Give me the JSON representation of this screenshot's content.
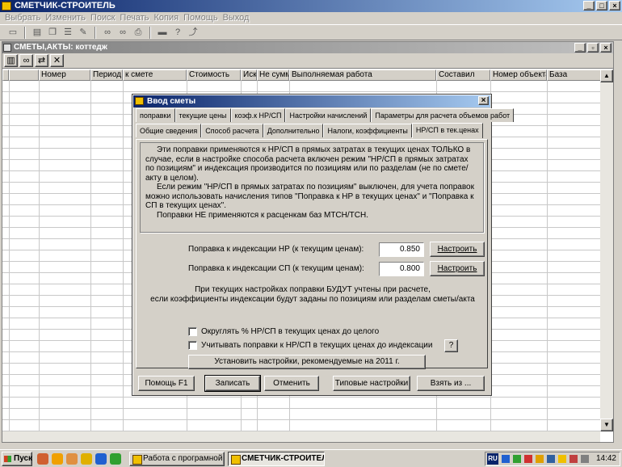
{
  "app": {
    "title": "СМЕТЧИК-СТРОИТЕЛЬ"
  },
  "menu": [
    "Выбрать",
    "Изменить",
    "Поиск",
    "Печать",
    "Копия",
    "Помощь",
    "Выход"
  ],
  "child_window": {
    "title": "СМЕТЫ,АКТЫ: коттедж",
    "columns": [
      "Номер",
      "Период",
      "к смете",
      "Стоимость",
      "Иск.",
      "Не сумм",
      "Выполняемая работа",
      "Составил",
      "Номер объекта",
      "База"
    ]
  },
  "dialog": {
    "title": "Ввод сметы",
    "tabs_row1": [
      "поправки",
      "текущие цены",
      "коэф.к НР/СП",
      "Настройки начислений",
      "Параметры для расчета объемов работ"
    ],
    "tabs_row2": [
      "Общие сведения",
      "Способ расчета",
      "Дополнительно",
      "Налоги, коэффициенты",
      "НР/СП в тек.ценах"
    ],
    "active_tab": "НР/СП в тек.ценах",
    "info_paragraphs": [
      "Эти поправки применяются к НР/СП в прямых затратах в текущих ценах ТОЛЬКО в случае, если в настройке способа расчета включен режим \"НР/СП в прямых затратах по позициям\" и индексация производится по позициям или по разделам (не по смете/акту в целом).",
      "Если режим \"НР/СП в прямых затратах по позициям\" выключен, для учета поправок можно использовать начисления типов \"Поправка к НР в текущих ценах\" и \"Поправка к СП в текущих ценах\".",
      "Поправки НЕ применяются к расценкам баз МТСН/ТСН."
    ],
    "nr_label": "Поправка к индексации НР (к текущим ценам):",
    "nr_value": "0.850",
    "sp_label": "Поправка к индексации СП (к текущим ценам):",
    "sp_value": "0.800",
    "setup_label": "Настроить",
    "note_line1": "При текущих настройках поправки БУДУТ учтены при расчете,",
    "note_line2": "если коэффициенты индексации будут заданы по позициям или разделам сметы/акта",
    "checkbox1": "Округлять % НР/СП в текущих ценах до целого",
    "checkbox2": "Учитывать поправки к НР/СП в текущих ценах до индексации",
    "help_label": "?",
    "recommend_button": "Установить настройки, рекомендуемые на 2011 г.",
    "buttons": {
      "help": "Помощь F1",
      "save": "Записать",
      "cancel": "Отменить",
      "typical": "Типовые настройки",
      "take": "Взять из ..."
    }
  },
  "taskbar": {
    "start": "Пуск",
    "task1": "Работа с програмной \"Г...",
    "task2": "СМЕТЧИК-СТРОИТЕЛЬ",
    "lang": "RU",
    "clock": "14:42"
  }
}
